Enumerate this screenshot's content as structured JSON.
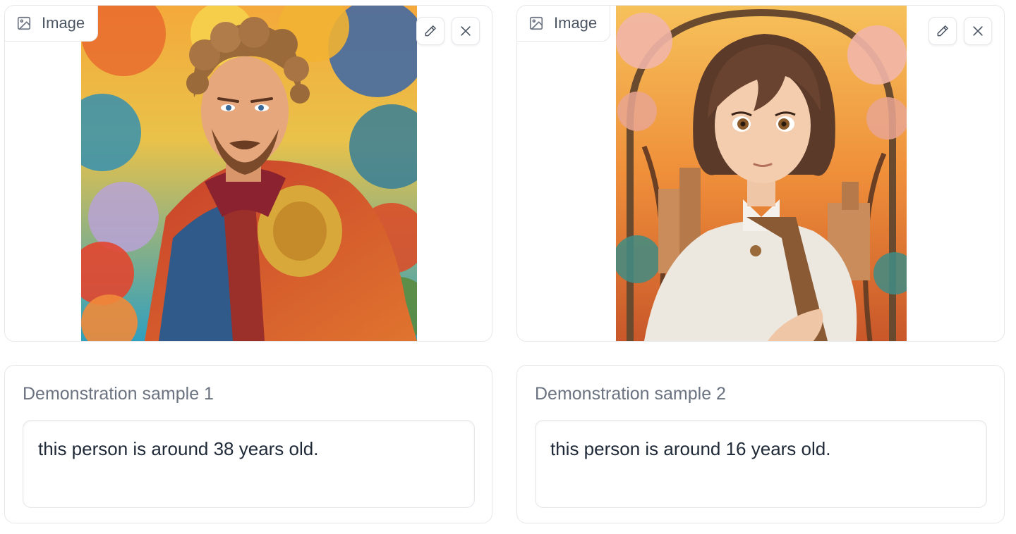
{
  "samples": [
    {
      "image_label": "Image",
      "image_label_icon": "image-icon",
      "edit_icon": "pencil-icon",
      "clear_icon": "close-icon",
      "text_label": "Demonstration sample 1",
      "text_value": "this person is around 38 years old."
    },
    {
      "image_label": "Image",
      "image_label_icon": "image-icon",
      "edit_icon": "pencil-icon",
      "clear_icon": "close-icon",
      "text_label": "Demonstration sample 2",
      "text_value": "this person is around 16 years old."
    }
  ],
  "colors": {
    "border": "#e5e7eb",
    "label_text": "#6b7280",
    "body_text": "#1f2937"
  }
}
